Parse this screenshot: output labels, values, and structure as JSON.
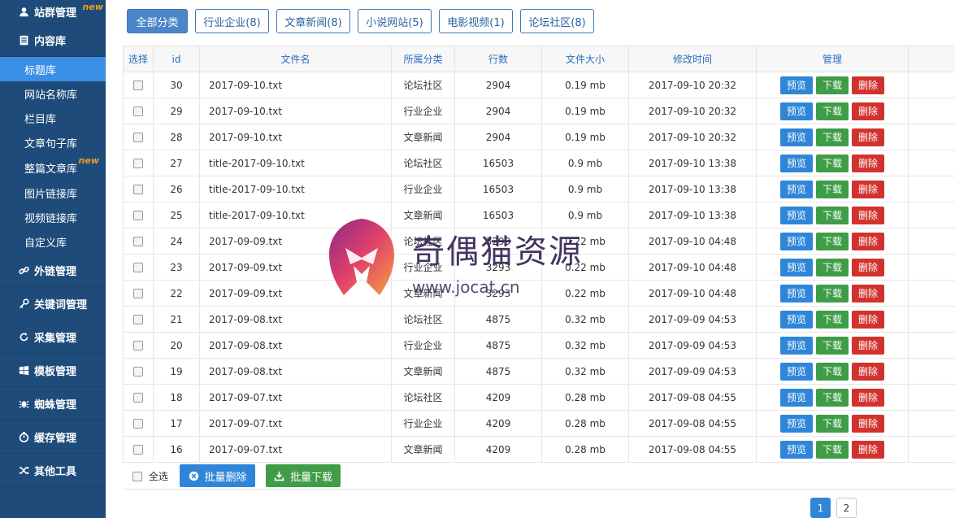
{
  "sidebar": {
    "top_item": {
      "label": "站群管理",
      "badge": "new",
      "icon": "user-icon"
    },
    "content_section": {
      "label": "内容库",
      "icon": "document-icon"
    },
    "sub_items": [
      {
        "label": "标题库",
        "active": true
      },
      {
        "label": "网站名称库"
      },
      {
        "label": "栏目库"
      },
      {
        "label": "文章句子库"
      },
      {
        "label": "整篇文章库",
        "badge": "new"
      },
      {
        "label": "图片链接库"
      },
      {
        "label": "视频链接库"
      },
      {
        "label": "自定义库"
      }
    ],
    "menus": [
      {
        "label": "外链管理",
        "icon": "link-icon"
      },
      {
        "label": "关键词管理",
        "icon": "key-icon"
      },
      {
        "label": "采集管理",
        "icon": "refresh-icon"
      },
      {
        "label": "模板管理",
        "icon": "windows-icon"
      },
      {
        "label": "蜘蛛管理",
        "icon": "spider-icon"
      },
      {
        "label": "缓存管理",
        "icon": "timer-icon"
      },
      {
        "label": "其他工具",
        "icon": "shuffle-icon"
      }
    ]
  },
  "categories": [
    {
      "label": "全部分类",
      "active": true
    },
    {
      "label": "行业企业(8)"
    },
    {
      "label": "文章新闻(8)"
    },
    {
      "label": "小说网站(5)"
    },
    {
      "label": "电影视频(1)"
    },
    {
      "label": "论坛社区(8)"
    }
  ],
  "table": {
    "headers": [
      "选择",
      "id",
      "文件名",
      "所属分类",
      "行数",
      "文件大小",
      "修改时间",
      "管理"
    ],
    "action_labels": {
      "preview": "预览",
      "download": "下载",
      "delete": "删除"
    },
    "rows": [
      {
        "id": "30",
        "file": "2017-09-10.txt",
        "category": "论坛社区",
        "lines": "2904",
        "size": "0.19 mb",
        "modified": "2017-09-10 20:32"
      },
      {
        "id": "29",
        "file": "2017-09-10.txt",
        "category": "行业企业",
        "lines": "2904",
        "size": "0.19 mb",
        "modified": "2017-09-10 20:32"
      },
      {
        "id": "28",
        "file": "2017-09-10.txt",
        "category": "文章新闻",
        "lines": "2904",
        "size": "0.19 mb",
        "modified": "2017-09-10 20:32"
      },
      {
        "id": "27",
        "file": "title-2017-09-10.txt",
        "category": "论坛社区",
        "lines": "16503",
        "size": "0.9 mb",
        "modified": "2017-09-10 13:38"
      },
      {
        "id": "26",
        "file": "title-2017-09-10.txt",
        "category": "行业企业",
        "lines": "16503",
        "size": "0.9 mb",
        "modified": "2017-09-10 13:38"
      },
      {
        "id": "25",
        "file": "title-2017-09-10.txt",
        "category": "文章新闻",
        "lines": "16503",
        "size": "0.9 mb",
        "modified": "2017-09-10 13:38"
      },
      {
        "id": "24",
        "file": "2017-09-09.txt",
        "category": "论坛社区",
        "lines": "3293",
        "size": "0.22 mb",
        "modified": "2017-09-10 04:48"
      },
      {
        "id": "23",
        "file": "2017-09-09.txt",
        "category": "行业企业",
        "lines": "3293",
        "size": "0.22 mb",
        "modified": "2017-09-10 04:48"
      },
      {
        "id": "22",
        "file": "2017-09-09.txt",
        "category": "文章新闻",
        "lines": "3293",
        "size": "0.22 mb",
        "modified": "2017-09-10 04:48"
      },
      {
        "id": "21",
        "file": "2017-09-08.txt",
        "category": "论坛社区",
        "lines": "4875",
        "size": "0.32 mb",
        "modified": "2017-09-09 04:53"
      },
      {
        "id": "20",
        "file": "2017-09-08.txt",
        "category": "行业企业",
        "lines": "4875",
        "size": "0.32 mb",
        "modified": "2017-09-09 04:53"
      },
      {
        "id": "19",
        "file": "2017-09-08.txt",
        "category": "文章新闻",
        "lines": "4875",
        "size": "0.32 mb",
        "modified": "2017-09-09 04:53"
      },
      {
        "id": "18",
        "file": "2017-09-07.txt",
        "category": "论坛社区",
        "lines": "4209",
        "size": "0.28 mb",
        "modified": "2017-09-08 04:55"
      },
      {
        "id": "17",
        "file": "2017-09-07.txt",
        "category": "行业企业",
        "lines": "4209",
        "size": "0.28 mb",
        "modified": "2017-09-08 04:55"
      },
      {
        "id": "16",
        "file": "2017-09-07.txt",
        "category": "文章新闻",
        "lines": "4209",
        "size": "0.28 mb",
        "modified": "2017-09-08 04:55"
      }
    ]
  },
  "footer": {
    "select_all": "全选",
    "batch_delete": "批量删除",
    "batch_download": "批量下载"
  },
  "pagination": {
    "pages": [
      "1",
      "2"
    ],
    "current": "1"
  },
  "watermark": {
    "title": "奇偶猫资源",
    "url": "www.jocat.cn"
  },
  "colors": {
    "sidebar": "#1e4b7a",
    "active_item": "#3a8ee6",
    "preview": "#2f86d8",
    "download": "#3f9c47",
    "delete": "#d2322d",
    "new_badge": "#f0a020"
  }
}
